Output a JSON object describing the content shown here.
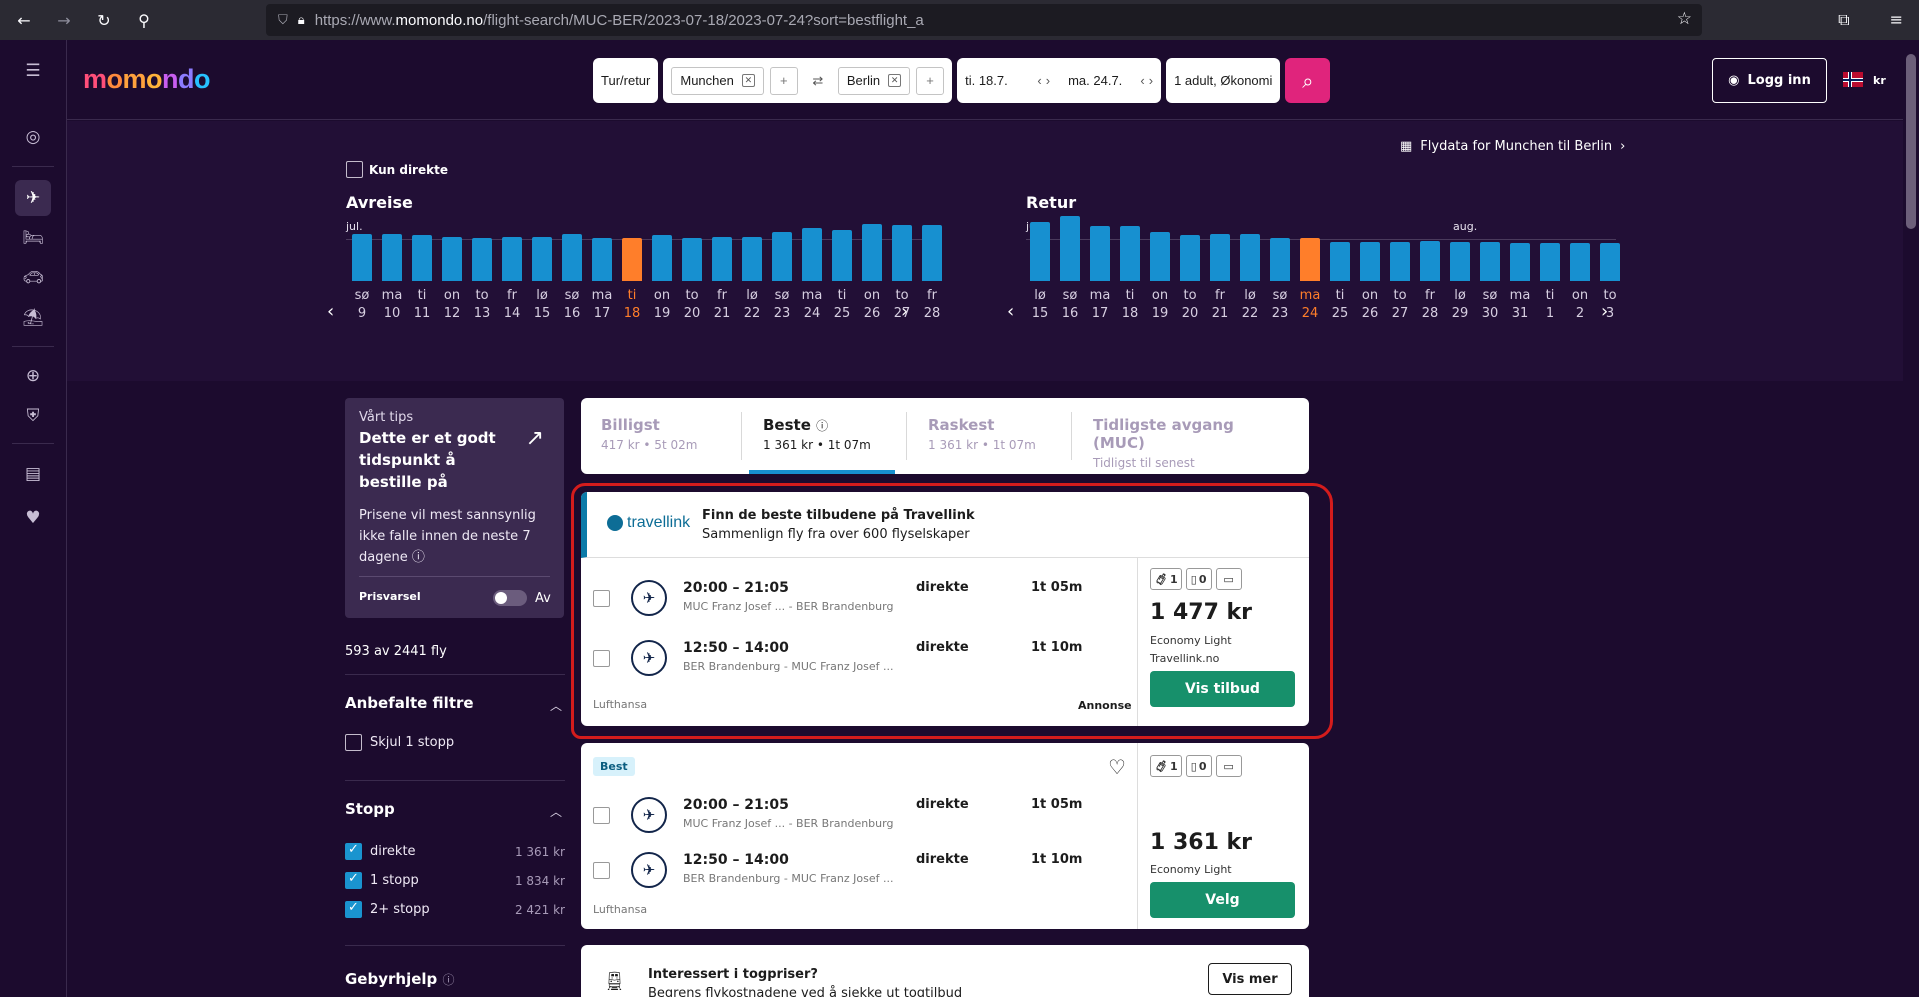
{
  "browser": {
    "url_prefix": "https://www.",
    "url_domain": "momondo.no",
    "url_path": "/flight-search/MUC-BER/2023-07-18/2023-07-24?sort=bestflight_a"
  },
  "header": {
    "logo_text": "momondo",
    "trip_type": "Tur/retur",
    "origin": "Munchen",
    "destination": "Berlin",
    "depart_date": "ti. 18.7.",
    "return_date": "ma. 24.7.",
    "travelers": "1 adult, Økonomi",
    "login_label": "Logg inn",
    "currency": "kr"
  },
  "calendar": {
    "direct_only_label": "Kun direkte",
    "flydata_label": "Flydata for Munchen til Berlin",
    "depart": {
      "title": "Avreise",
      "month": "jul.",
      "days": [
        {
          "n": "sø",
          "d": "9",
          "v": 0.72
        },
        {
          "n": "ma",
          "d": "10",
          "v": 0.72
        },
        {
          "n": "ti",
          "d": "11",
          "v": 0.7
        },
        {
          "n": "on",
          "d": "12",
          "v": 0.68
        },
        {
          "n": "to",
          "d": "13",
          "v": 0.66
        },
        {
          "n": "fr",
          "d": "14",
          "v": 0.68
        },
        {
          "n": "lø",
          "d": "15",
          "v": 0.68
        },
        {
          "n": "sø",
          "d": "16",
          "v": 0.72
        },
        {
          "n": "ma",
          "d": "17",
          "v": 0.66
        },
        {
          "n": "ti",
          "d": "18",
          "v": 0.66,
          "sel": true
        },
        {
          "n": "on",
          "d": "19",
          "v": 0.7
        },
        {
          "n": "to",
          "d": "20",
          "v": 0.66
        },
        {
          "n": "fr",
          "d": "21",
          "v": 0.68
        },
        {
          "n": "lø",
          "d": "22",
          "v": 0.68
        },
        {
          "n": "sø",
          "d": "23",
          "v": 0.76
        },
        {
          "n": "ma",
          "d": "24",
          "v": 0.82
        },
        {
          "n": "ti",
          "d": "25",
          "v": 0.78
        },
        {
          "n": "on",
          "d": "26",
          "v": 0.88
        },
        {
          "n": "to",
          "d": "27",
          "v": 0.86
        },
        {
          "n": "fr",
          "d": "28",
          "v": 0.86
        }
      ]
    },
    "return": {
      "title": "Retur",
      "month": "jul.",
      "month2": "aug.",
      "days": [
        {
          "n": "lø",
          "d": "15",
          "v": 0.9
        },
        {
          "n": "sø",
          "d": "16",
          "v": 1.0
        },
        {
          "n": "ma",
          "d": "17",
          "v": 0.84
        },
        {
          "n": "ti",
          "d": "18",
          "v": 0.84
        },
        {
          "n": "on",
          "d": "19",
          "v": 0.76
        },
        {
          "n": "to",
          "d": "20",
          "v": 0.7
        },
        {
          "n": "fr",
          "d": "21",
          "v": 0.72
        },
        {
          "n": "lø",
          "d": "22",
          "v": 0.72
        },
        {
          "n": "sø",
          "d": "23",
          "v": 0.66
        },
        {
          "n": "ma",
          "d": "24",
          "v": 0.66,
          "sel": true
        },
        {
          "n": "ti",
          "d": "25",
          "v": 0.6
        },
        {
          "n": "on",
          "d": "26",
          "v": 0.6
        },
        {
          "n": "to",
          "d": "27",
          "v": 0.6
        },
        {
          "n": "fr",
          "d": "28",
          "v": 0.62
        },
        {
          "n": "lø",
          "d": "29",
          "v": 0.6
        },
        {
          "n": "sø",
          "d": "30",
          "v": 0.6
        },
        {
          "n": "ma",
          "d": "31",
          "v": 0.58
        },
        {
          "n": "ti",
          "d": "1",
          "v": 0.58
        },
        {
          "n": "on",
          "d": "2",
          "v": 0.58
        },
        {
          "n": "to",
          "d": "3",
          "v": 0.58
        }
      ]
    }
  },
  "tip": {
    "kicker": "Vårt tips",
    "headline": "Dette er et godt tidspunkt å bestille på",
    "description": "Prisene vil mest sannsynlig ikke falle innen de neste 7 dagene",
    "price_alert_label": "Prisvarsel",
    "price_alert_state": "Av"
  },
  "results_count": "593 av 2441 fly",
  "filters": {
    "recommended_title": "Anbefalte filtre",
    "hide_1_stop": "Skjul 1 stopp",
    "stops_title": "Stopp",
    "stops": [
      {
        "label": "direkte",
        "price": "1 361 kr"
      },
      {
        "label": "1 stopp",
        "price": "1 834 kr"
      },
      {
        "label": "2+ stopp",
        "price": "2 421 kr"
      }
    ],
    "fees_title": "Gebyrhjelp"
  },
  "sort_tabs": [
    {
      "title": "Billigst",
      "sub": "417 kr • 5t 02m"
    },
    {
      "title": "Beste",
      "sub": "1 361 kr • 1t 07m"
    },
    {
      "title": "Raskest",
      "sub": "1 361 kr • 1t 07m"
    },
    {
      "title": "Tidligste avgang (MUC)",
      "sub": "Tidligst til senest"
    }
  ],
  "ad": {
    "brand": "travellink",
    "heading": "Finn de beste tilbudene på Travellink",
    "subheading": "Sammenlign fly fra over 600 flyselskaper",
    "legs": [
      {
        "times": "20:00 – 21:05",
        "route": "MUC Franz Josef ... - BER Brandenburg",
        "stop": "direkte",
        "dur": "1t 05m"
      },
      {
        "times": "12:50 – 14:00",
        "route": "BER Brandenburg - MUC Franz Josef ...",
        "stop": "direkte",
        "dur": "1t 10m"
      }
    ],
    "airline": "Lufthansa",
    "annonse": "Annonse",
    "bag_carry": "1",
    "bag_checked": "0",
    "price": "1 477 kr",
    "fare": "Economy Light",
    "provider": "Travellink.no",
    "button": "Vis tilbud"
  },
  "result": {
    "badge": "Best",
    "legs": [
      {
        "times": "20:00 – 21:05",
        "route": "MUC Franz Josef ... - BER Brandenburg",
        "stop": "direkte",
        "dur": "1t 05m"
      },
      {
        "times": "12:50 – 14:00",
        "route": "BER Brandenburg - MUC Franz Josef ...",
        "stop": "direkte",
        "dur": "1t 10m"
      }
    ],
    "airline": "Lufthansa",
    "bag_carry": "1",
    "bag_checked": "0",
    "price": "1 361 kr",
    "fare": "Economy Light",
    "button": "Velg"
  },
  "train": {
    "title": "Interessert i togpriser?",
    "text": "Begrens flykostnadene ved å sjekke ut togtilbud",
    "button": "Vis mer"
  },
  "colors": {
    "bar": "#1790d0",
    "selected": "#ff7e2a",
    "accent": "#e0247c",
    "cta": "#17906b",
    "background": "#1c0b2e"
  }
}
